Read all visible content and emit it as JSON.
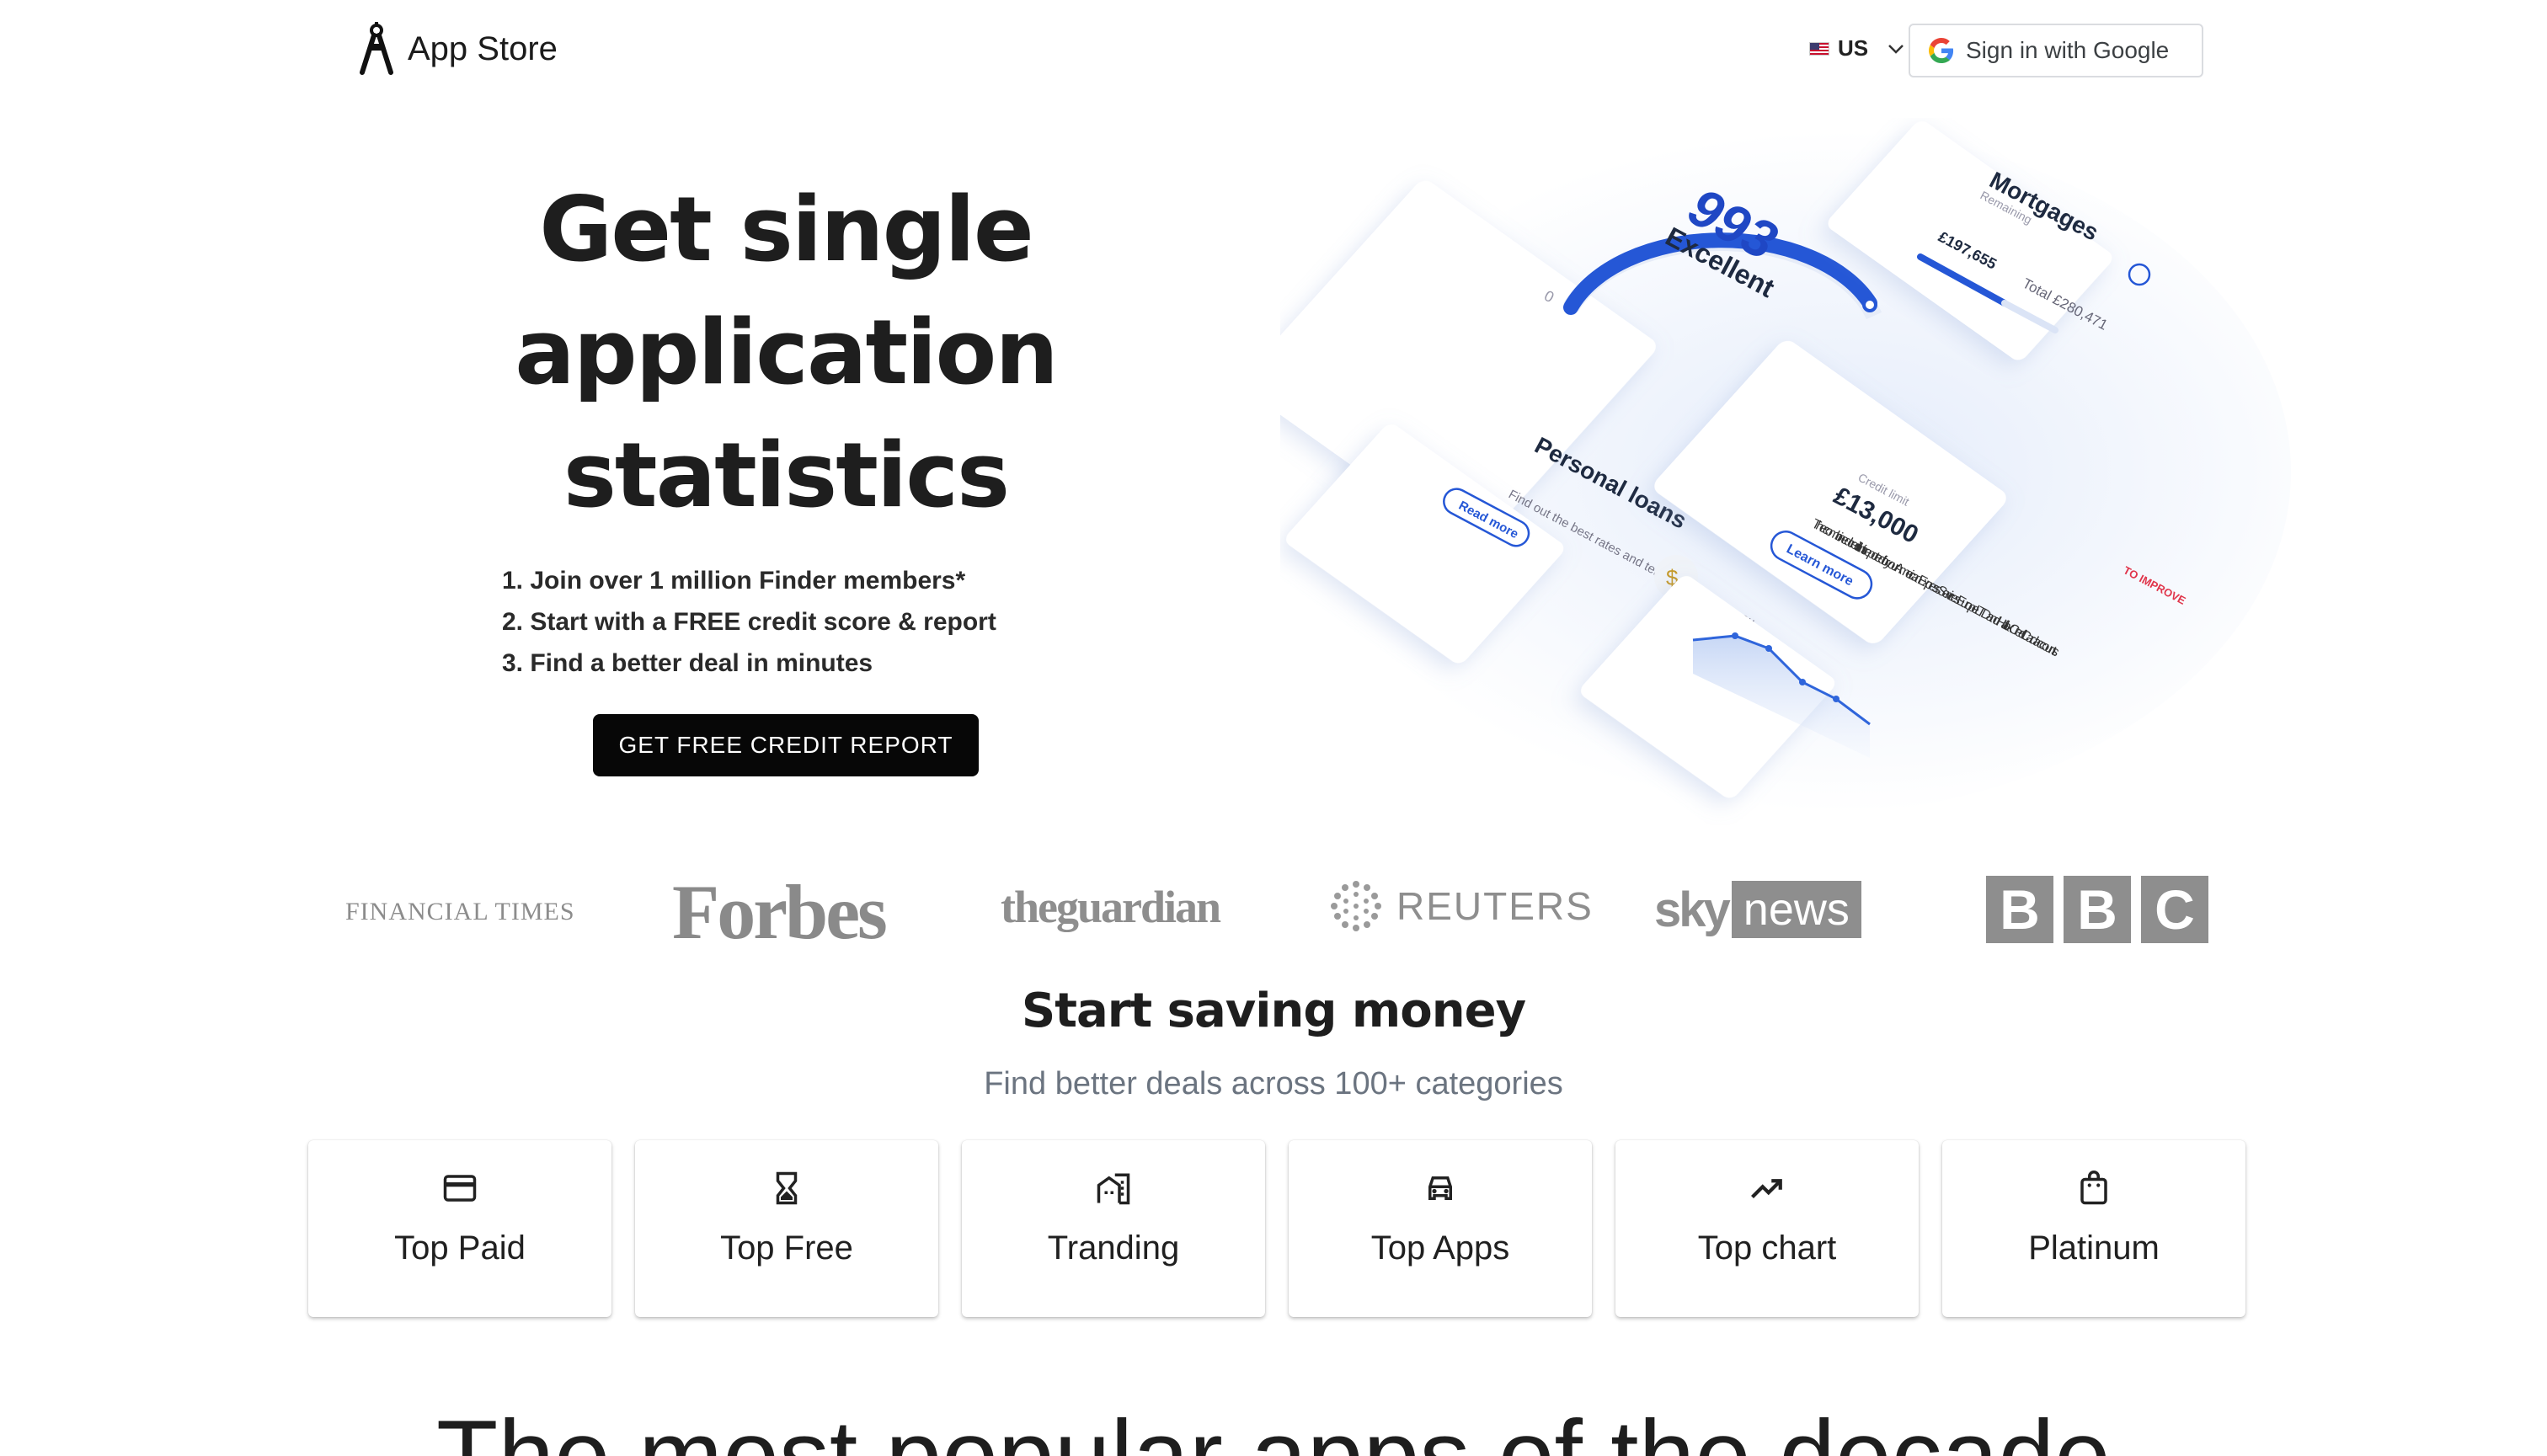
{
  "header": {
    "brand": "App Store",
    "region": "US",
    "signin_label": "Sign in with Google"
  },
  "hero": {
    "title": "Get single application statistics",
    "steps": [
      "1. Join over 1 million Finder members*",
      "2. Start with a FREE credit score & report",
      "3. Find a better deal in minutes"
    ],
    "cta_label": "GET FREE CREDIT REPORT",
    "illustration": {
      "score": "993",
      "score_label": "Excellent",
      "score_min": "0",
      "score_max": "1000",
      "score_fraction": 0.993,
      "mortgages_title": "Mortgages",
      "mortgages_sub": "Remaining",
      "mortgages_remaining": "£197,655",
      "mortgages_total": "Total £280,471",
      "loans_title": "Personal loans",
      "loans_text": "Find out the best rates and terms available to you",
      "loans_link": "Read more",
      "credit_label": "Credit limit",
      "credit_value": "£13,000",
      "credit_text": "The combined credit limits reported for your American Express Services Europe LTD and Halifax Credit Card accounts.",
      "credit_link": "Learn more",
      "credit_badge": "TO IMPROVE"
    }
  },
  "press": {
    "logos": [
      "FINANCIAL TIMES",
      "Forbes",
      "theguardian",
      "REUTERS",
      "sky",
      "news",
      "B",
      "B",
      "C"
    ]
  },
  "saving": {
    "title": "Start saving money",
    "subtitle": "Find better deals across 100+ categories",
    "categories": [
      {
        "label": "Top Paid",
        "icon": "credit-card-icon"
      },
      {
        "label": "Top Free",
        "icon": "hourglass-icon"
      },
      {
        "label": "Tranding",
        "icon": "buildings-icon"
      },
      {
        "label": "Top Apps",
        "icon": "car-icon"
      },
      {
        "label": "Top chart",
        "icon": "trending-up-icon"
      },
      {
        "label": "Platinum",
        "icon": "shopping-bag-icon"
      }
    ]
  },
  "popular": {
    "title": "The most popular apps of the decade"
  }
}
